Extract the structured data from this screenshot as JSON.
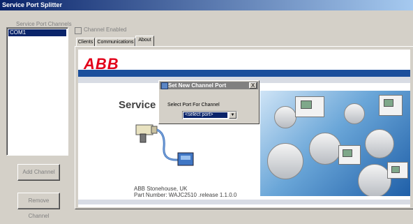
{
  "window": {
    "title": "Service Port Splitter"
  },
  "channels": {
    "label": "Service Port Channels",
    "items": [
      "COM1"
    ]
  },
  "buttons": {
    "add": "Add Channel",
    "remove": "Remove Channel"
  },
  "channel_enabled": {
    "label": "Channel Enabled",
    "checked": false
  },
  "tabs": [
    {
      "label": "Clients"
    },
    {
      "label": "Communications"
    },
    {
      "label": "About",
      "active": true
    }
  ],
  "about": {
    "logo": "ABB",
    "service_text": "Service",
    "footer_line1": "ABB Stonehouse, UK",
    "footer_line2": "Part Number:  WAJC2510 .release 1.1.0.0"
  },
  "dialog": {
    "title": "Set New Channel Port",
    "close": "X",
    "label": "Select Port For Channel",
    "select_value": "<select port>",
    "arrow": "▼"
  },
  "colors": {
    "accent": "#0a246a",
    "brand_red": "#e2001a",
    "band_blue": "#1b4f9c"
  }
}
